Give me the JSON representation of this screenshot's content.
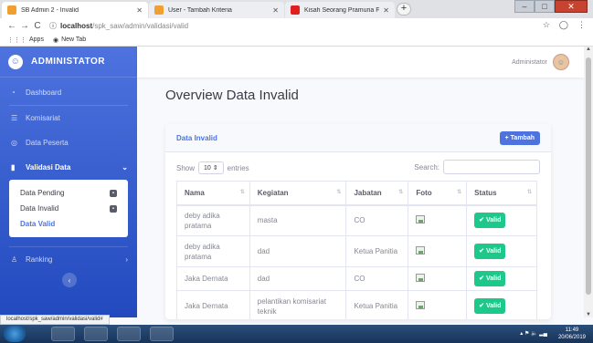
{
  "browser": {
    "tabs": [
      {
        "label": "SB Admin 2 - Invalid",
        "color": "#f0a030",
        "active": true
      },
      {
        "label": "User - Tambah Kriteria",
        "color": "#f0a030",
        "active": false
      },
      {
        "label": "Kisah Seorang Pramuria Felix Co",
        "color": "#e02020",
        "active": false
      }
    ],
    "url_host": "localhost",
    "url_path": "/spk_saw/admin/validasi/valid",
    "bookmarks": [
      "Apps",
      "New Tab"
    ],
    "status_url": "localhost/spk_saw/admin/validasi/valid#"
  },
  "sidebar": {
    "brand": "ADMINISTATOR",
    "items": {
      "dashboard": "Dashboard",
      "komisariat": "Komisariat",
      "data_peserta": "Data Peserta",
      "validasi_data": "Validasi Data",
      "ranking": "Ranking"
    },
    "submenu": {
      "pending": "Data Pending",
      "invalid": "Data Invalid",
      "valid": "Data Valid"
    }
  },
  "topbar": {
    "user_name": "Administator"
  },
  "page": {
    "title": "Overview Data Invalid"
  },
  "card": {
    "title": "Data Invalid",
    "add_label": "Tambah",
    "show_label": "Show",
    "entries_value": "10",
    "entries_label": "entries",
    "search_label": "Search:",
    "columns": [
      "Nama",
      "Kegiatan",
      "Jabatan",
      "Foto",
      "Status"
    ],
    "rows": [
      {
        "nama": "deby adika pratama",
        "kegiatan": "masta",
        "jabatan": "CO",
        "status": "Valid"
      },
      {
        "nama": "deby adika pratama",
        "kegiatan": "dad",
        "jabatan": "Ketua Panitia",
        "status": "Valid"
      },
      {
        "nama": "Jaka Dernata",
        "kegiatan": "dad",
        "jabatan": "CO",
        "status": "Valid"
      },
      {
        "nama": "Jaka Dernata",
        "kegiatan": "pelantikan komisariat teknik",
        "jabatan": "Ketua Panitia",
        "status": "Valid"
      }
    ]
  },
  "taskbar": {
    "time": "11:49",
    "date": "20/06/2019"
  },
  "colors": {
    "primary": "#4e73df",
    "success": "#1cc88a"
  }
}
